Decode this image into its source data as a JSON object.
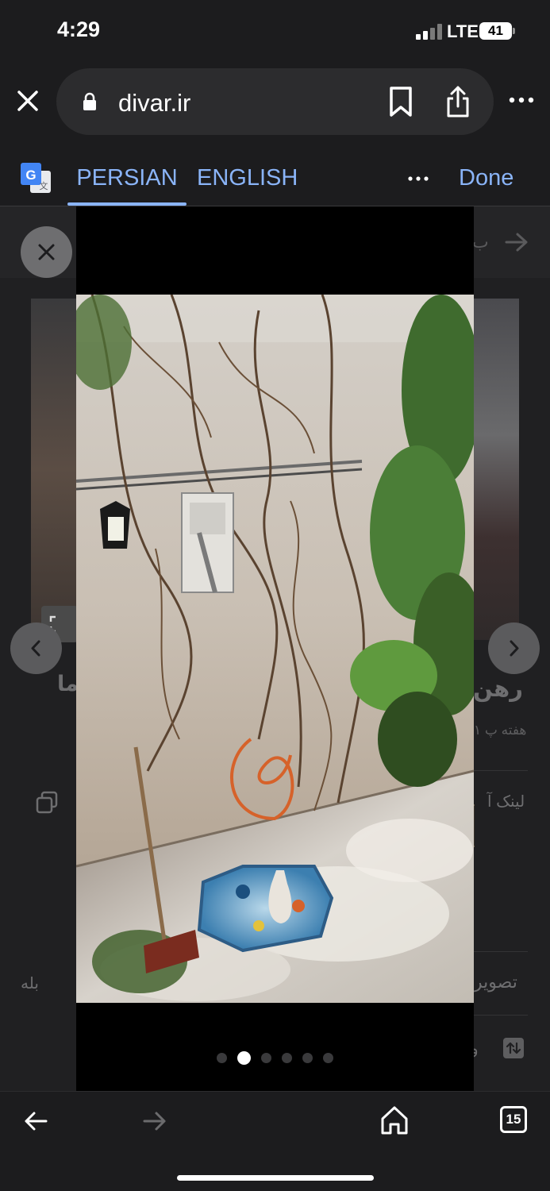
{
  "status_bar": {
    "time": "4:29",
    "network": "LTE",
    "battery": "41"
  },
  "browser": {
    "url": "divar.ir"
  },
  "translate_bar": {
    "tabs": [
      {
        "label": "PERSIAN",
        "selected": true
      },
      {
        "label": "ENGLISH",
        "selected": false
      }
    ],
    "done_label": "Done"
  },
  "background_page": {
    "header_fragment": "ب",
    "title_fragment_right": "رهن",
    "title_fragment_left": "ما",
    "time_fragment": "۱ هفته پ",
    "link_fragment": "لینک آ",
    "images_fragment": "تصویر",
    "yes_value": "بله",
    "row_fragment": "و"
  },
  "photo_viewer": {
    "image_count": 6,
    "current_index": 2
  },
  "toolbar": {
    "tab_count": "15"
  },
  "colors": {
    "accent": "#8ab4f8",
    "background": "#1c1c1e"
  }
}
